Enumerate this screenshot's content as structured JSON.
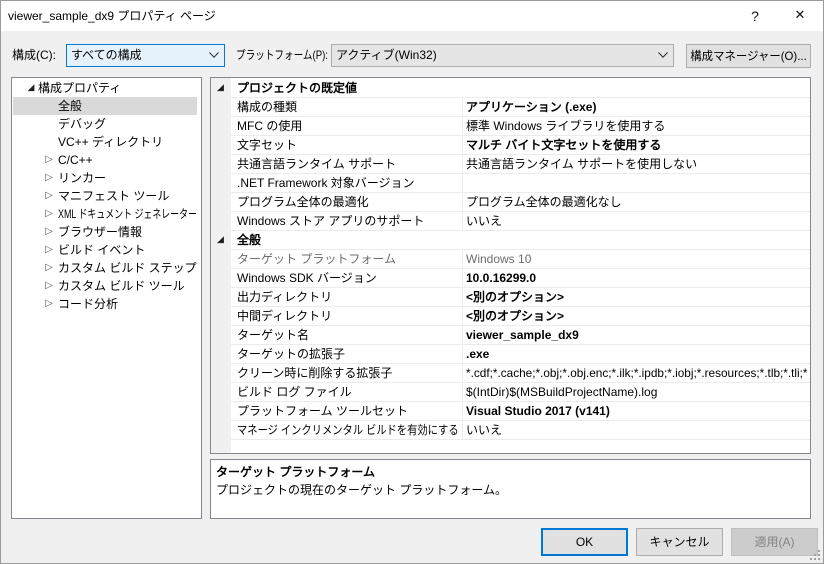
{
  "window": {
    "title": "viewer_sample_dx9 プロパティ ページ",
    "help_label": "?",
    "close_label": "✕"
  },
  "toolbar": {
    "configuration": {
      "label": "構成(C):",
      "value": "すべての構成"
    },
    "platform": {
      "label": "プラットフォーム(P):",
      "value": "アクティブ(Win32)"
    },
    "configuration_manager_label": "構成マネージャー(O)..."
  },
  "icons": {
    "expanded": "expanded-triangle-icon",
    "collapsed": "collapsed-triangle-icon",
    "dropdown": "chevron-down-icon",
    "help": "help-icon",
    "close": "close-icon",
    "resize_grip": "resize-grip-icon"
  },
  "tree": {
    "root": {
      "label": "構成プロパティ",
      "expanded": true
    },
    "items": [
      {
        "label": "全般",
        "selected": true,
        "expandable": false
      },
      {
        "label": "デバッグ",
        "expandable": false
      },
      {
        "label": "VC++ ディレクトリ",
        "expandable": false
      },
      {
        "label": "C/C++",
        "expandable": true
      },
      {
        "label": "リンカー",
        "expandable": true
      },
      {
        "label": "マニフェスト ツール",
        "expandable": true
      },
      {
        "label": "XML ドキュメント ジェネレーター",
        "expandable": true
      },
      {
        "label": "ブラウザー情報",
        "expandable": true
      },
      {
        "label": "ビルド イベント",
        "expandable": true
      },
      {
        "label": "カスタム ビルド ステップ",
        "expandable": true
      },
      {
        "label": "カスタム ビルド ツール",
        "expandable": true
      },
      {
        "label": "コード分析",
        "expandable": true
      }
    ]
  },
  "grid": {
    "categories": [
      {
        "label": "プロジェクトの既定値",
        "expanded": true,
        "rows": [
          {
            "name": "構成の種類",
            "value": "アプリケーション (.exe)",
            "bold": true
          },
          {
            "name": "MFC の使用",
            "value": "標準 Windows ライブラリを使用する"
          },
          {
            "name": "文字セット",
            "value": "マルチ バイト文字セットを使用する",
            "bold": true
          },
          {
            "name": "共通言語ランタイム サポート",
            "value": "共通言語ランタイム サポートを使用しない"
          },
          {
            "name": ".NET Framework 対象バージョン",
            "value": ""
          },
          {
            "name": "プログラム全体の最適化",
            "value": "プログラム全体の最適化なし"
          },
          {
            "name": "Windows ストア アプリのサポート",
            "value": "いいえ"
          }
        ]
      },
      {
        "label": "全般",
        "expanded": true,
        "rows": [
          {
            "name": "ターゲット プラットフォーム",
            "value": "Windows 10",
            "disabled": true
          },
          {
            "name": "Windows SDK バージョン",
            "value": "10.0.16299.0",
            "bold": true
          },
          {
            "name": "出力ディレクトリ",
            "value": "<別のオプション>",
            "bold": true
          },
          {
            "name": "中間ディレクトリ",
            "value": "<別のオプション>",
            "bold": true
          },
          {
            "name": "ターゲット名",
            "value": "viewer_sample_dx9",
            "bold": true
          },
          {
            "name": "ターゲットの拡張子",
            "value": ".exe",
            "bold": true
          },
          {
            "name": "クリーン時に削除する拡張子",
            "value": "*.cdf;*.cache;*.obj;*.obj.enc;*.ilk;*.ipdb;*.iobj;*.resources;*.tlb;*.tli;*"
          },
          {
            "name": "ビルド ログ ファイル",
            "value": "$(IntDir)$(MSBuildProjectName).log"
          },
          {
            "name": "プラットフォーム ツールセット",
            "value": "Visual Studio 2017 (v141)",
            "bold": true
          },
          {
            "name": "マネージ インクリメンタル ビルドを有効にする",
            "value": "いいえ"
          }
        ]
      }
    ]
  },
  "description": {
    "title": "ターゲット プラットフォーム",
    "text": "プロジェクトの現在のターゲット プラットフォーム。"
  },
  "buttons": {
    "ok": {
      "label": "OK",
      "enabled": true,
      "default": true
    },
    "cancel": {
      "label": "キャンセル",
      "enabled": true
    },
    "apply": {
      "label": "適用(A)",
      "enabled": false
    }
  },
  "colors": {
    "accent": "#0078d7",
    "window_background": "#f0f0f0",
    "tree_selection": "#d9d9d9",
    "disabled_text": "#6d6d6d",
    "grid_line": "#ececec"
  }
}
